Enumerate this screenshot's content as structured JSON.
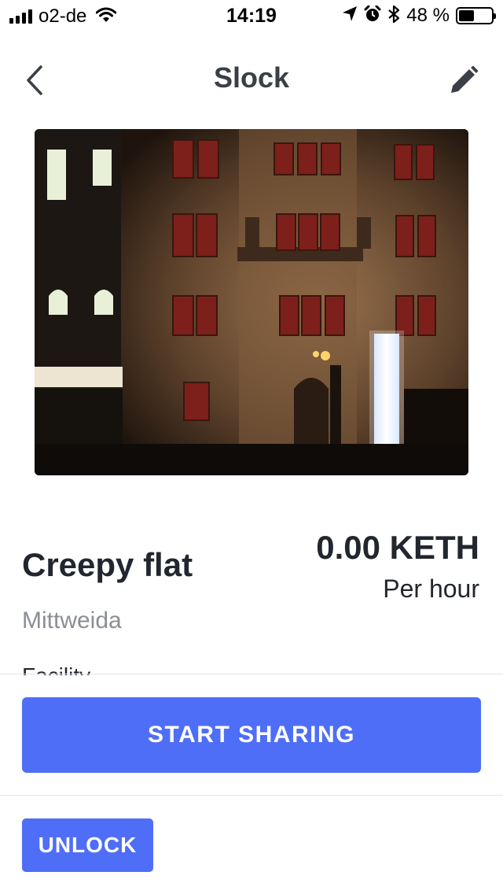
{
  "status_bar": {
    "carrier": "o2-de",
    "time": "14:19",
    "battery_percent": "48 %",
    "battery_level": 0.48,
    "icons": [
      "signal-icon",
      "wifi-icon",
      "location-arrow-icon",
      "alarm-icon",
      "bluetooth-icon",
      "battery-icon"
    ]
  },
  "nav": {
    "title": "Slock",
    "back_icon": "chevron-left-icon",
    "edit_icon": "pencil-icon"
  },
  "item": {
    "name": "Creepy flat",
    "location": "Mittweida",
    "price": "0.00 KETH",
    "price_unit": "Per hour",
    "partial_text": "Facility"
  },
  "actions": {
    "primary_label": "START SHARING",
    "secondary_label": "UNLOCK"
  },
  "colors": {
    "accent": "#4f6ef7",
    "text_primary": "#22262e",
    "text_secondary": "#8a8e95",
    "nav_title": "#3a3f47"
  }
}
